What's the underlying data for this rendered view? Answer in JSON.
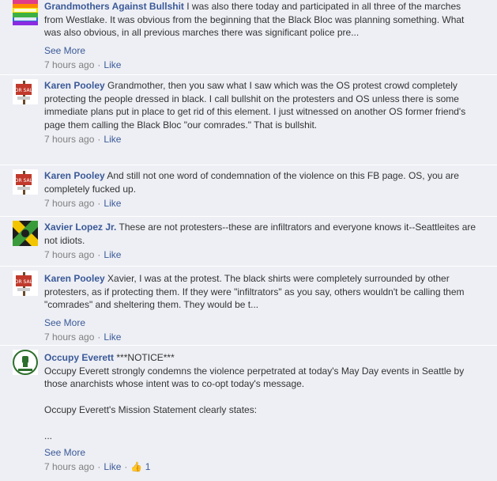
{
  "comments": [
    {
      "author": "Grandmothers Against Bullshit",
      "avatar_icon": "rainbow-strike-avatar",
      "text": "I was also there today and participated in all three of the marches from Westlake. It was obvious from the beginning that the Black Bloc was planning something. What was also obvious, in all previous marches there was significant police pre...",
      "see_more": "See More",
      "time": "7 hours ago",
      "like": "Like"
    },
    {
      "author": "Karen Pooley",
      "avatar_icon": "for-sale-sign-avatar",
      "text": "Grandmother, then you saw what I saw which was the OS protest crowd completely protecting the people dressed in black. I call bullshit on the protesters and OS unless there is some immediate plans put in place to get rid of this element. I just witnessed on another OS former friend's page them calling the Black Bloc \"our comrades.\" That is bullshit.",
      "time": "7 hours ago",
      "like": "Like"
    },
    {
      "author": "Karen Pooley",
      "avatar_icon": "for-sale-sign-avatar",
      "text": "And still not one word of condemnation of the violence on this FB page. OS, you are completely fucked up.",
      "time": "7 hours ago",
      "like": "Like"
    },
    {
      "author": "Xavier Lopez Jr.",
      "avatar_icon": "x-flag-avatar",
      "text": "These are not protesters--these are infiltrators and everyone knows it--Seattleites are not idiots.",
      "time": "7 hours ago",
      "like": "Like"
    },
    {
      "author": "Karen Pooley",
      "avatar_icon": "for-sale-sign-avatar",
      "text": "Xavier, I was at the protest. The black shirts were completely surrounded by other protesters, as if protecting them. If they were \"infiltrators\" as you say, others wouldn't be calling them \"comrades\" and sheltering them. They would be t...",
      "see_more": "See More",
      "time": "7 hours ago",
      "like": "Like"
    },
    {
      "author": "Occupy Everett",
      "avatar_icon": "raised-fist-avatar",
      "text": "***NOTICE***",
      "text_line2": "Occupy Everett strongly condemns the violence perpetrated at today's May Day events in Seattle by those anarchists whose intent was to co-opt today's message.",
      "text_line3": "Occupy Everett's Mission Statement clearly states:",
      "text_line4": "...",
      "see_more": "See More",
      "time": "7 hours ago",
      "like": "Like",
      "like_count": "1"
    }
  ]
}
